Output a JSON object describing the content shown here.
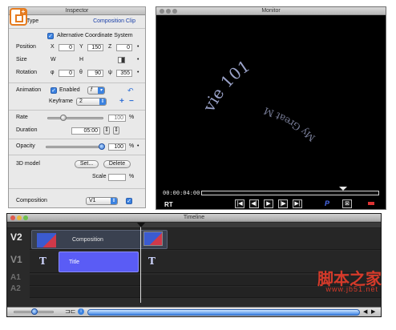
{
  "inspector": {
    "title": "Inspector",
    "type_label": "Type",
    "type_value": "Composition Clip",
    "alt_coord_label": "Alternative Coordinate System",
    "position": {
      "label": "Position",
      "x_label": "X",
      "x": "0",
      "y_label": "Y",
      "y": "150",
      "z_label": "Z",
      "z": "0"
    },
    "size": {
      "label": "Size",
      "w_label": "W",
      "h_label": "H"
    },
    "rotation": {
      "label": "Rotation",
      "a_label": "φ",
      "a": "0",
      "b_label": "θ",
      "b": "90",
      "c_label": "ψ",
      "c": "355"
    },
    "animation": {
      "label": "Animation",
      "enabled_label": "Enabled",
      "func_value": "f",
      "keyframe_label": "Keyframe",
      "keyframe_value": "2"
    },
    "rate": {
      "label": "Rate",
      "value": "100",
      "unit": "%"
    },
    "duration": {
      "label": "Duration",
      "value": "05:00"
    },
    "opacity": {
      "label": "Opacity",
      "value": "100",
      "unit": "%"
    },
    "model3d": {
      "label": "3D model",
      "set_label": "Set...",
      "delete_label": "Delete",
      "scale_label": "Scale",
      "scale_unit": "%"
    },
    "composition": {
      "label": "Composition",
      "value": "V1"
    }
  },
  "monitor": {
    "title": "Monitor",
    "timecode": "00:00:04:00",
    "rt_label": "RT",
    "preview_text": "vie 101 My Great M",
    "ctrl_start": "|◀",
    "ctrl_stepback": "◀|",
    "ctrl_play": "▶",
    "ctrl_stepfwd": "|▶",
    "ctrl_end": "▶|",
    "p_label": "P"
  },
  "timeline": {
    "title": "Timeline",
    "tracks": [
      "V2",
      "V1",
      "A1",
      "A2"
    ],
    "clip_composition": "Composition",
    "clip_title": "Title",
    "title_glyph": "T"
  },
  "watermark": {
    "zh": "脚本之家",
    "url": "www.jb51.net"
  }
}
